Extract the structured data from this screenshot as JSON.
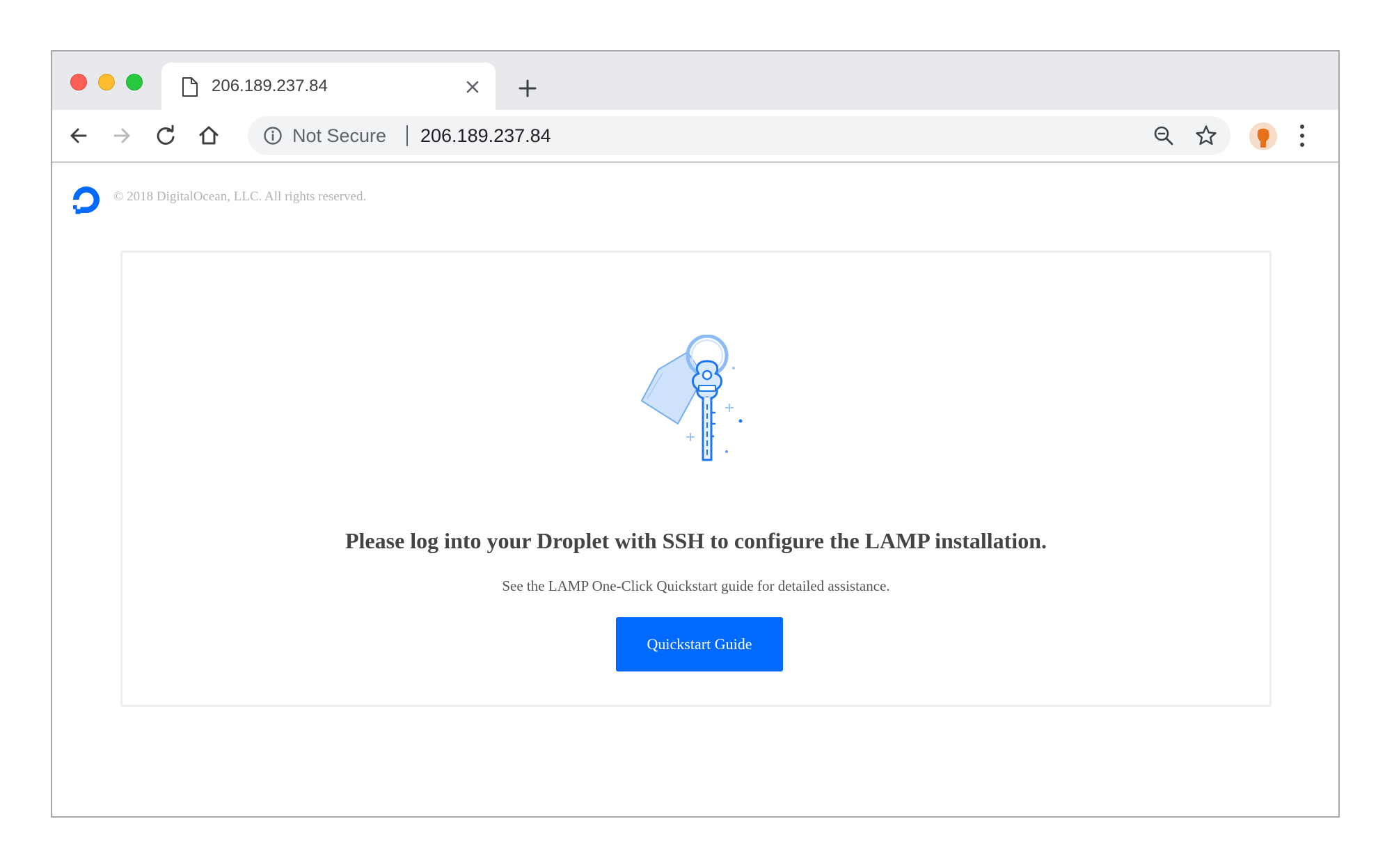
{
  "browser": {
    "tab": {
      "title": "206.189.237.84",
      "icon": "document-icon"
    },
    "new_tab_icon": "plus-icon",
    "toolbar": {
      "back_icon": "back-arrow-icon",
      "forward_icon": "forward-arrow-icon",
      "reload_icon": "reload-icon",
      "home_icon": "home-icon"
    },
    "omnibox": {
      "security_label": "Not Secure",
      "url": "206.189.237.84",
      "zoom_icon": "zoom-out-icon",
      "bookmark_icon": "star-icon"
    },
    "menu_icon": "kebab-menu-icon"
  },
  "page": {
    "copyright": "© 2018 DigitalOcean, LLC. All rights reserved.",
    "card": {
      "headline": "Please log into your Droplet with SSH to configure the LAMP installation.",
      "subtext": "See the LAMP One-Click Quickstart guide for detailed assistance.",
      "button_label": "Quickstart Guide"
    }
  },
  "colors": {
    "brand_blue": "#0069ff",
    "tabstrip": "#e7e9ec",
    "omnibox": "#f1f3f4"
  }
}
